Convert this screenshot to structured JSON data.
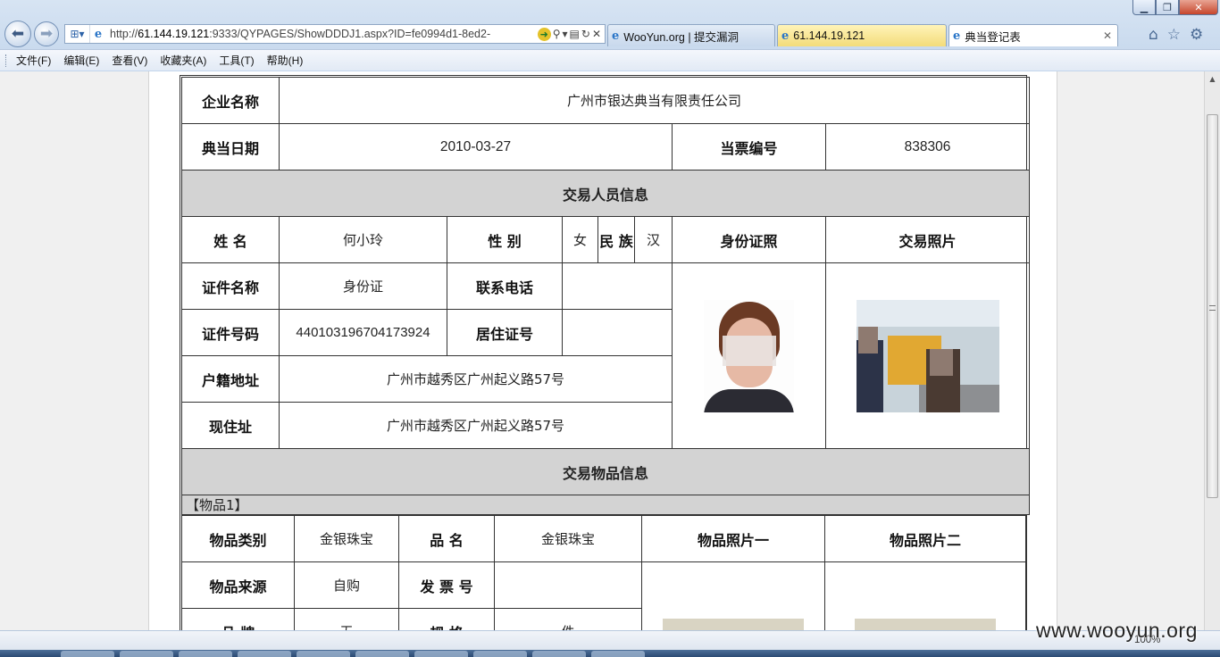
{
  "browser": {
    "address": {
      "url_prefix": "http://",
      "url_host": "61.144.19.121",
      "url_rest": ":9333/QYPAGES/ShowDDDJ1.aspx?ID=fe0994d1-8ed2-"
    },
    "tabs": [
      {
        "label": "WooYun.org | 提交漏洞"
      },
      {
        "label": "61.144.19.121"
      },
      {
        "label": "典当登记表"
      }
    ],
    "menu": [
      "文件(F)",
      "编辑(E)",
      "查看(V)",
      "收藏夹(A)",
      "工具(T)",
      "帮助(H)"
    ],
    "zoom": "100%",
    "watermark": "www.wooyun.org"
  },
  "form": {
    "company_label": "企业名称",
    "company_value": "广州市银达典当有限责任公司",
    "date_label": "典当日期",
    "date_value": "2010-03-27",
    "ticket_label": "当票编号",
    "ticket_value": "838306",
    "person_section": "交易人员信息",
    "name_label": "姓 名",
    "name_value": "何小玲",
    "gender_label": "性 别",
    "gender_value": "女",
    "ethnic_label": "民 族",
    "ethnic_value": "汉",
    "id_photo_label": "身份证照",
    "tx_photo_label": "交易照片",
    "doc_type_label": "证件名称",
    "doc_type_value": "身份证",
    "phone_label": "联系电话",
    "phone_value": "",
    "doc_no_label": "证件号码",
    "doc_no_value": "440103196704173924",
    "residence_permit_label": "居住证号",
    "residence_permit_value": "",
    "hukou_label": "户籍地址",
    "hukou_value": "广州市越秀区广州起义路57号",
    "current_addr_label": "现住址",
    "current_addr_value": "广州市越秀区广州起义路57号",
    "goods_section": "交易物品信息",
    "item_header": "【物品1】",
    "category_label": "物品类别",
    "category_value": "金银珠宝",
    "product_name_label": "品 名",
    "product_name_value": "金银珠宝",
    "photo1_label": "物品照片一",
    "photo2_label": "物品照片二",
    "source_label": "物品来源",
    "source_value": "自购",
    "invoice_label": "发 票 号",
    "invoice_value": "",
    "brand_label": "品 牌",
    "brand_value": "无",
    "spec_label": "规 格",
    "spec_value": "件"
  }
}
